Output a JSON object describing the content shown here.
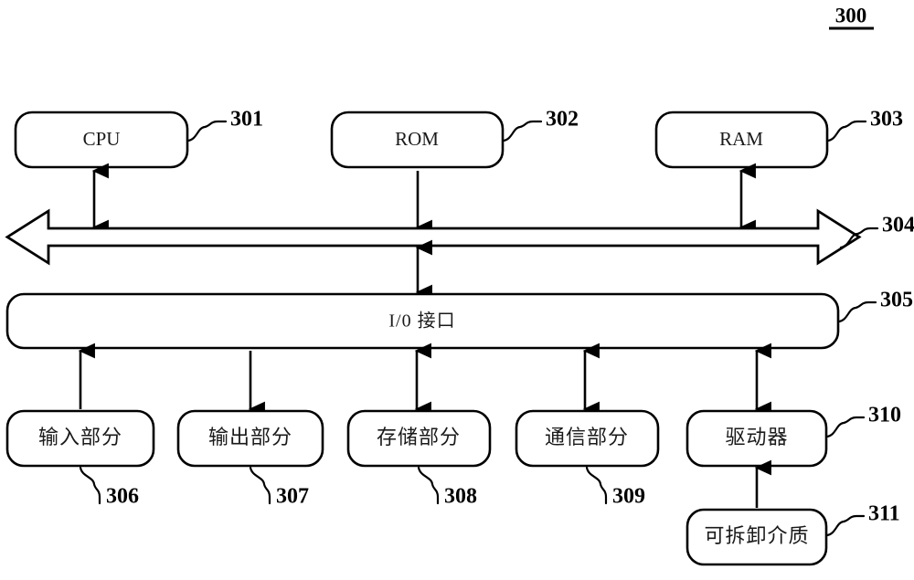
{
  "figure": {
    "number": "300",
    "title_position": "top-right"
  },
  "colors": {
    "stroke": "#000000",
    "fill": "#ffffff",
    "text": "#1a1a1a"
  },
  "nodes": [
    {
      "id": "cpu",
      "label": "CPU",
      "ref": "301",
      "lang": "latin"
    },
    {
      "id": "rom",
      "label": "ROM",
      "ref": "302",
      "lang": "latin"
    },
    {
      "id": "ram",
      "label": "RAM",
      "ref": "303",
      "lang": "latin"
    },
    {
      "id": "bus",
      "label": "",
      "ref": "304",
      "lang": "none"
    },
    {
      "id": "io-interface",
      "label": "I/0 接口",
      "ref": "305",
      "lang": "cjk"
    },
    {
      "id": "input-part",
      "label": "输入部分",
      "ref": "306",
      "lang": "cjk"
    },
    {
      "id": "output-part",
      "label": "输出部分",
      "ref": "307",
      "lang": "cjk"
    },
    {
      "id": "storage-part",
      "label": "存储部分",
      "ref": "308",
      "lang": "cjk"
    },
    {
      "id": "comm-part",
      "label": "通信部分",
      "ref": "309",
      "lang": "cjk"
    },
    {
      "id": "driver",
      "label": "驱动器",
      "ref": "310",
      "lang": "cjk"
    },
    {
      "id": "removable",
      "label": "可拆卸介质",
      "ref": "311",
      "lang": "cjk"
    }
  ],
  "connections": [
    {
      "from": "cpu",
      "to": "bus",
      "direction": "bidirectional"
    },
    {
      "from": "rom",
      "to": "bus",
      "direction": "down"
    },
    {
      "from": "ram",
      "to": "bus",
      "direction": "bidirectional"
    },
    {
      "from": "bus",
      "to": "io-interface",
      "direction": "bidirectional"
    },
    {
      "from": "input-part",
      "to": "io-interface",
      "direction": "up"
    },
    {
      "from": "io-interface",
      "to": "output-part",
      "direction": "down"
    },
    {
      "from": "storage-part",
      "to": "io-interface",
      "direction": "bidirectional"
    },
    {
      "from": "comm-part",
      "to": "io-interface",
      "direction": "bidirectional"
    },
    {
      "from": "driver",
      "to": "io-interface",
      "direction": "bidirectional"
    },
    {
      "from": "removable",
      "to": "driver",
      "direction": "up"
    }
  ]
}
